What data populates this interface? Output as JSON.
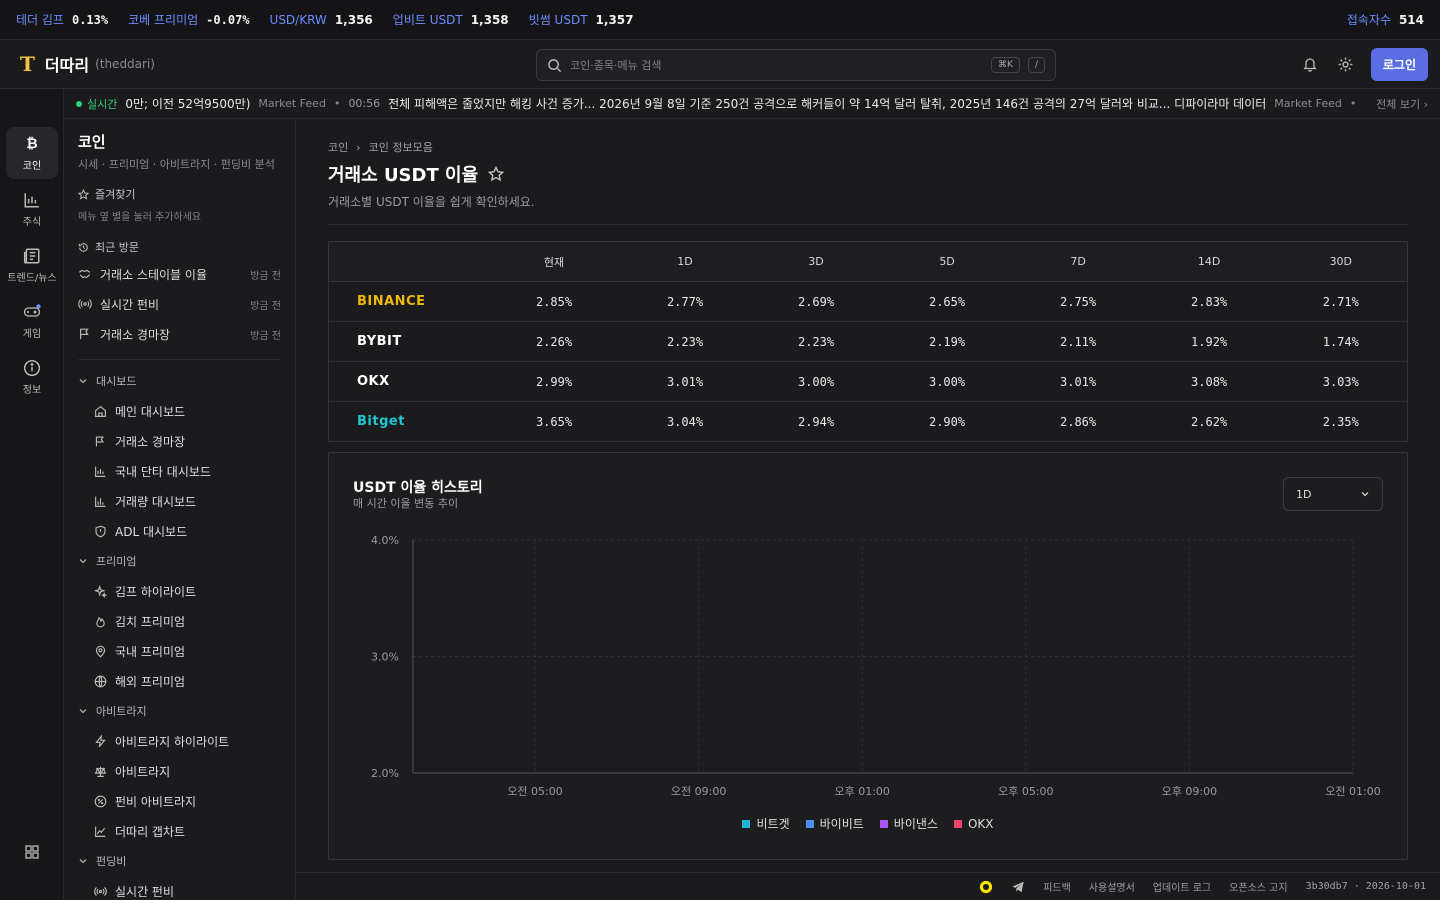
{
  "ticker": {
    "items": [
      {
        "label": "테더 김프",
        "value": "0.13%"
      },
      {
        "label": "코베 프리미엄",
        "value": "-0.07%"
      },
      {
        "label": "USD/KRW",
        "value": "1,356"
      },
      {
        "label": "업비트 USDT",
        "value": "1,358"
      },
      {
        "label": "빗썸 USDT",
        "value": "1,357"
      }
    ],
    "users_label": "접속자수",
    "users_value": "514"
  },
  "header": {
    "logo_mark": "T",
    "name": "더따리",
    "sub": "(theddari)",
    "search_placeholder": "코인·종목·메뉴 검색",
    "kbd1": "⌘K",
    "kbd2": "/",
    "login": "로그인"
  },
  "news": {
    "live": "실시간",
    "item1": "0만; 이전 52억9500만)",
    "src1": "Market Feed",
    "time2": "00:56",
    "item2": "전체 피해액은 줄었지만 해킹 사건 증가... 2026년 9월 8일 기준 250건 공격으로 해커들이 약 14억 달러 탈취, 2025년 146건 공격의 27억 달러와 비교... 디파이라마 데이터",
    "src2": "Market Feed",
    "more": "전체 보기 ›"
  },
  "rail": [
    {
      "label": "코인",
      "icon": "bitcoin-icon"
    },
    {
      "label": "주식",
      "icon": "stock-chart-icon"
    },
    {
      "label": "트렌드/뉴스",
      "icon": "newspaper-icon"
    },
    {
      "label": "게임",
      "icon": "gamepad-icon"
    },
    {
      "label": "정보",
      "icon": "info-icon"
    }
  ],
  "sidebar": {
    "title": "코인",
    "subtitle": "시세 · 프리미엄 · 아비트라지 · 펀딩비 분석",
    "favorites": "즐겨찾기",
    "favorites_hint": "메뉴 옆 별을 눌러 추가하세요",
    "recent": "최근 방문",
    "recent_items": [
      {
        "label": "거래소 스테이블 이율",
        "ago": "방금 전"
      },
      {
        "label": "실시간 펀비",
        "ago": "방금 전"
      },
      {
        "label": "거래소 경마장",
        "ago": "방금 전"
      }
    ],
    "groups": {
      "dashboard": "대시보드",
      "dashboard_items": [
        "메인 대시보드",
        "거래소 경마장",
        "국내 단타 대시보드",
        "거래량 대시보드",
        "ADL 대시보드"
      ],
      "premium": "프리미엄",
      "premium_items": [
        "김프 하이라이트",
        "김치 프리미엄",
        "국내 프리미엄",
        "해외 프리미엄"
      ],
      "arb": "아비트라지",
      "arb_items": [
        "아비트라지 하이라이트",
        "아비트라지",
        "펀비 아비트라지",
        "더따리 갭차트"
      ],
      "funding": "펀딩비",
      "funding_items": [
        "실시간 펀비"
      ]
    }
  },
  "main": {
    "crumb1": "코인",
    "crumb2": "코인 정보모음",
    "title": "거래소 USDT 이율",
    "desc": "거래소별 USDT 이율을 쉽게 확인하세요.",
    "columns": [
      "현재",
      "1D",
      "3D",
      "5D",
      "7D",
      "14D",
      "30D"
    ],
    "rows": [
      {
        "exchange": "BINANCE",
        "color": "#f0b90b",
        "values": [
          "2.85%",
          "2.77%",
          "2.69%",
          "2.65%",
          "2.75%",
          "2.83%",
          "2.71%"
        ]
      },
      {
        "exchange": "BYBIT",
        "color": "#ffffff",
        "values": [
          "2.26%",
          "2.23%",
          "2.23%",
          "2.19%",
          "2.11%",
          "1.92%",
          "1.74%"
        ]
      },
      {
        "exchange": "OKX",
        "color": "#ffffff",
        "values": [
          "2.99%",
          "3.01%",
          "3.00%",
          "3.00%",
          "3.01%",
          "3.08%",
          "3.03%"
        ]
      },
      {
        "exchange": "Bitget",
        "color": "#1fc7d4",
        "values": [
          "3.65%",
          "3.04%",
          "2.94%",
          "2.90%",
          "2.86%",
          "2.62%",
          "2.35%"
        ]
      }
    ]
  },
  "chart_data": {
    "type": "line",
    "title": "USDT 이율 히스토리",
    "subtitle": "매 시간 이율 변동 추이",
    "x": [
      "오전 05:00",
      "오전 09:00",
      "오후 01:00",
      "오후 05:00",
      "오후 09:00",
      "오전 01:00"
    ],
    "yticks": [
      "2.0%",
      "3.0%",
      "4.0%"
    ],
    "ylim": [
      2.0,
      4.0
    ],
    "series": [
      {
        "name": "비트겟",
        "color": "#1fb5d4",
        "values": []
      },
      {
        "name": "바이비트",
        "color": "#4e8df5",
        "values": []
      },
      {
        "name": "바이낸스",
        "color": "#a855f7",
        "values": []
      },
      {
        "name": "OKX",
        "color": "#ef4770",
        "values": []
      }
    ],
    "range_selected": "1D",
    "grid": true,
    "legend": "bottom"
  },
  "footer": {
    "feedback": "피드백",
    "manual": "사용설명서",
    "updates": "업데이트 로그",
    "oss": "오픈소스 고지",
    "version": "3b30db7 · 2026-10-01"
  }
}
